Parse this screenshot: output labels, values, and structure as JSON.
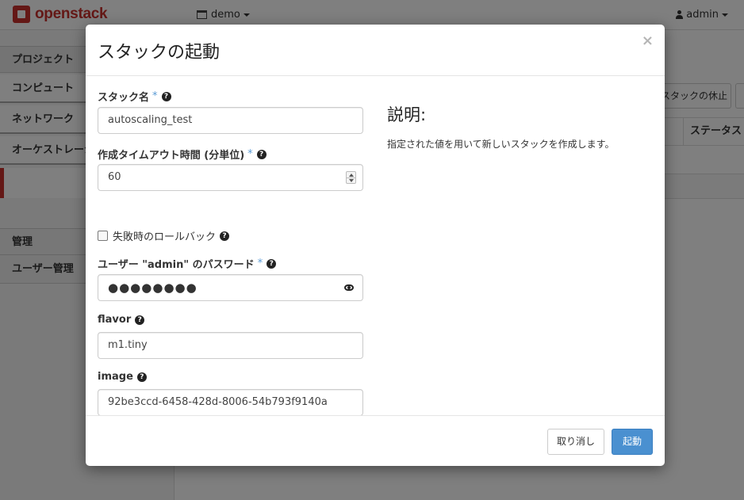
{
  "app": {
    "logo_text": "openstack",
    "project": "demo",
    "user": "admin"
  },
  "sidebar": {
    "sections": [
      {
        "label": "プロジェクト"
      },
      {
        "label": "管理"
      }
    ],
    "items": [
      {
        "label": "コンピュート"
      },
      {
        "label": "ネットワーク"
      },
      {
        "label": "オーケストレーション"
      },
      {
        "label": "ユーザー管理"
      }
    ]
  },
  "main": {
    "suspend_button": "スタックの休止",
    "table_status_header": "ステータス"
  },
  "modal": {
    "title": "スタックの起動",
    "close": "×",
    "fields": {
      "stack_name": {
        "label": "スタック名",
        "required": "*",
        "value": "autoscaling_test"
      },
      "timeout": {
        "label": "作成タイムアウト時間 (分単位)",
        "required": "*",
        "value": "60"
      },
      "rollback": {
        "label": "失敗時のロールバック",
        "checked": false
      },
      "password": {
        "label": "ユーザー \"admin\" のパスワード",
        "required": "*",
        "value": "●●●●●●●●"
      },
      "flavor": {
        "label": "flavor",
        "value": "m1.tiny"
      },
      "image": {
        "label": "image",
        "value": "92be3ccd-6458-428d-8006-54b793f9140a"
      }
    },
    "help_glyph": "?",
    "description": {
      "title": "説明:",
      "text": "指定された値を用いて新しいスタックを作成します。"
    },
    "buttons": {
      "cancel": "取り消し",
      "launch": "起動"
    }
  }
}
